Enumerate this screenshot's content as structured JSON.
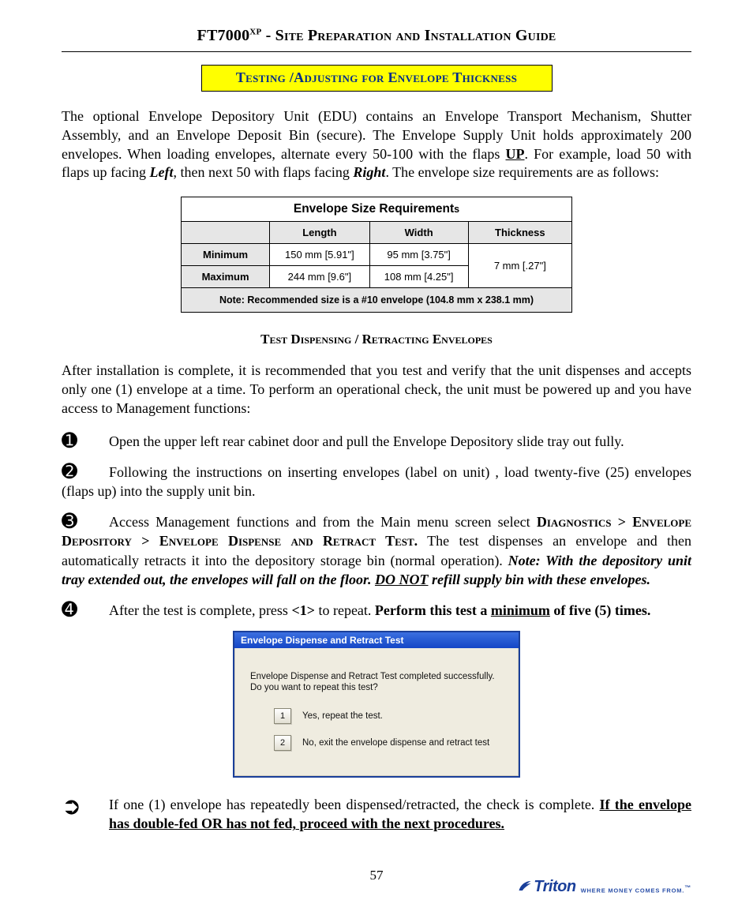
{
  "header": {
    "model_prefix": "FT7000",
    "model_super": "XP",
    "title_rest": " - Site Preparation and Installation Guide"
  },
  "section_box": "Testing /Adjusting for Envelope Thickness",
  "intro": {
    "part1": "The optional Envelope Depository Unit (EDU) contains an Envelope Transport Mechanism, Shutter Assembly, and an Envelope Deposit Bin (secure). The Envelope Supply Unit holds approximately 200 envelopes. When loading envelopes, alternate every 50-100 with the flaps ",
    "up": "UP",
    "part2": ". For example, load 50 with flaps up facing ",
    "left": "Left",
    "part3": ", then next 50 with flaps facing ",
    "right": "Right",
    "part4": ".  The envelope size requirements are as follows:"
  },
  "table": {
    "title": "Envelope Size Requirement",
    "title_suffix": "s",
    "headers": [
      "",
      "Length",
      "Width",
      "Thickness"
    ],
    "rows": [
      {
        "label": "Minimum",
        "length": "150 mm [5.91\"]",
        "width": "95 mm [3.75\"]"
      },
      {
        "label": "Maximum",
        "length": "244 mm [9.6\"]",
        "width": "108 mm [4.25\"]"
      }
    ],
    "thickness": "7 mm [.27\"]",
    "note": "Note:  Recommended size is a #10 envelope (104.8 mm x 238.1 mm)"
  },
  "subsection": "Test Dispensing / Retracting Envelopes",
  "after_install": "After installation is complete, it is recommended that you test and verify that the unit dispenses and accepts only one (1) envelope at a time. To perform an operational check, the unit must be powered up and you have access to Management functions:",
  "steps": {
    "s1": "Open the upper left rear cabinet door and pull the Envelope Depository slide tray out fully.",
    "s2": "Following the instructions on inserting envelopes (label on unit) , load twenty-five (25) envelopes (flaps up) into the supply unit bin.",
    "s3": {
      "pre": "Access Management functions and from the Main menu screen select ",
      "nav": "Diagnostics > Envelope Depository >  Envelope Dispense and Retract Test.",
      "mid": "  The test dispenses an envelope and then automatically retracts it into the depository storage bin (normal operation).  ",
      "note_label": "Note: With the depository unit tray extended out, the envelopes will fall on the floor.  ",
      "donot": "DO NOT",
      "note_tail": " refill supply bin with these envelopes."
    },
    "s4": {
      "pre": "After the test is complete, press ",
      "key": "<1>",
      "mid": " to repeat. ",
      "bold_pre": "Perform this test a ",
      "min": "minimum",
      "bold_post": " of five (5) times."
    },
    "arrow": {
      "pre": "If one (1) envelope has repeatedly been dispensed/retracted, the check is complete. ",
      "bold": "If the envelope has double-fed OR has not fed, proceed with the next procedures."
    }
  },
  "dialog": {
    "title": "Envelope Dispense and Retract Test",
    "line1": "Envelope Dispense and Retract Test completed successfully.",
    "line2": "Do you want to repeat this test?",
    "opt1_key": "1",
    "opt1_text": "Yes, repeat the test.",
    "opt2_key": "2",
    "opt2_text": "No, exit the envelope dispense and retract test"
  },
  "page_number": "57",
  "footer": {
    "brand": "Triton",
    "tagline": "WHERE MONEY COMES FROM.",
    "tm": "™"
  }
}
